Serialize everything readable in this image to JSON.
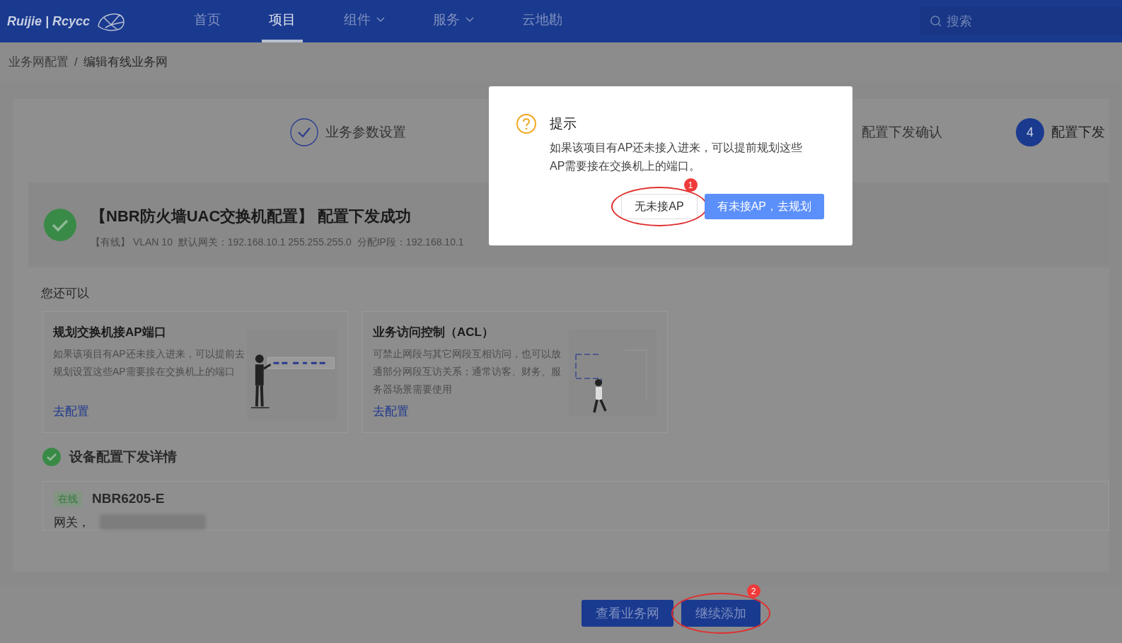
{
  "header": {
    "logo": "Ruijie | Rcycc",
    "nav": [
      {
        "label": "首页",
        "selected": false,
        "dropdown": false
      },
      {
        "label": "项目",
        "selected": true,
        "dropdown": false
      },
      {
        "label": "组件",
        "selected": false,
        "dropdown": true
      },
      {
        "label": "服务",
        "selected": false,
        "dropdown": true
      },
      {
        "label": "云地勘",
        "selected": false,
        "dropdown": false
      }
    ],
    "search": {
      "placeholder": "搜索"
    }
  },
  "breadcrumb": [
    "业务网配置",
    "/",
    "编辑有线业务网"
  ],
  "steps": [
    {
      "label": "业务参数设置",
      "kind": "done"
    },
    {
      "label": "配置下发确认",
      "kind": "plain"
    },
    {
      "label": "配置下发",
      "number": "4",
      "kind": "current"
    }
  ],
  "result": {
    "title": "【NBR防火墙UAC交换机配置】 配置下发成功",
    "detail": "【有线】 VLAN 10  默认网关：192.168.10.1 255.255.255.0  分配IP段：192.168.10.1"
  },
  "more": {
    "title": "您还可以",
    "cards": [
      {
        "title": "规划交换机接AP端口",
        "text": "如果该项目有AP还未接入进来，可以提前去规划设置这些AP需要接在交换机上的端口",
        "link": "去配置",
        "kind": "switch"
      },
      {
        "title": "业务访问控制（ACL）",
        "text": "可禁止网段与其它网段互相访问，也可以放通部分网段互访关系；通常访客、财务、服务器场景需要使用",
        "link": "去配置",
        "kind": "acl"
      }
    ]
  },
  "details": {
    "title": "设备配置下发详情",
    "devices": [
      {
        "status": "在线",
        "name": "NBR6205-E",
        "label": "网关，"
      }
    ]
  },
  "footer": {
    "buttons": [
      "查看业务网",
      "继续添加"
    ]
  },
  "dialog": {
    "title": "提示",
    "message": "如果该项目有AP还未接入进来，可以提前规划这些AP需要接在交换机上的端口。",
    "buttons": [
      {
        "label": "无未接AP",
        "primary": false
      },
      {
        "label": "有未接AP，去规划",
        "primary": true
      }
    ]
  },
  "annotations": [
    "1",
    "2"
  ]
}
